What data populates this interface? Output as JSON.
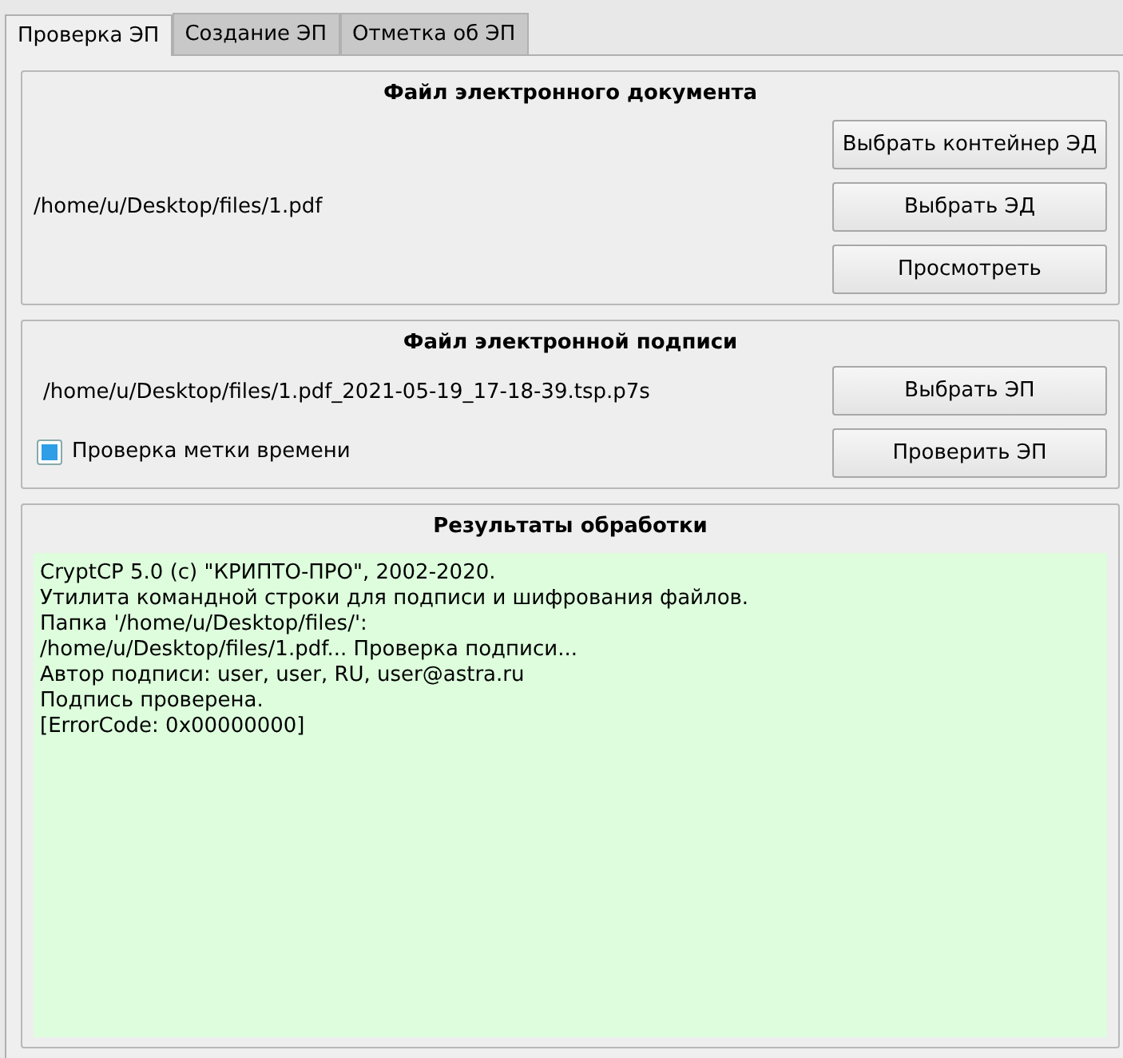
{
  "tabs": [
    {
      "label": "Проверка ЭП",
      "selected": true
    },
    {
      "label": "Создание ЭП",
      "selected": false
    },
    {
      "label": "Отметка об ЭП",
      "selected": false
    }
  ],
  "document_group": {
    "title": "Файл электронного документа",
    "path": "/home/u/Desktop/files/1.pdf",
    "buttons": [
      "Выбрать контейнер ЭД",
      "Выбрать ЭД",
      "Просмотреть"
    ]
  },
  "signature_group": {
    "title": "Файл электронной подписи",
    "path": "/home/u/Desktop/files/1.pdf_2021-05-19_17-18-39.tsp.p7s",
    "checkbox": {
      "label": "Проверка метки времени",
      "checked": true
    },
    "buttons": [
      "Выбрать ЭП",
      "Проверить ЭП"
    ]
  },
  "results_group": {
    "title": "Результаты обработки",
    "lines": [
      "CryptCP 5.0 (c) \"КРИПТО-ПРО\", 2002-2020.",
      "Утилита командной строки для подписи и шифрования файлов.",
      "Папка '/home/u/Desktop/files/':",
      "/home/u/Desktop/files/1.pdf... Проверка подписи...",
      "Автор подписи: user, user, RU, user@astra.ru",
      "Подпись проверена.",
      "[ErrorCode: 0x00000000]"
    ]
  }
}
